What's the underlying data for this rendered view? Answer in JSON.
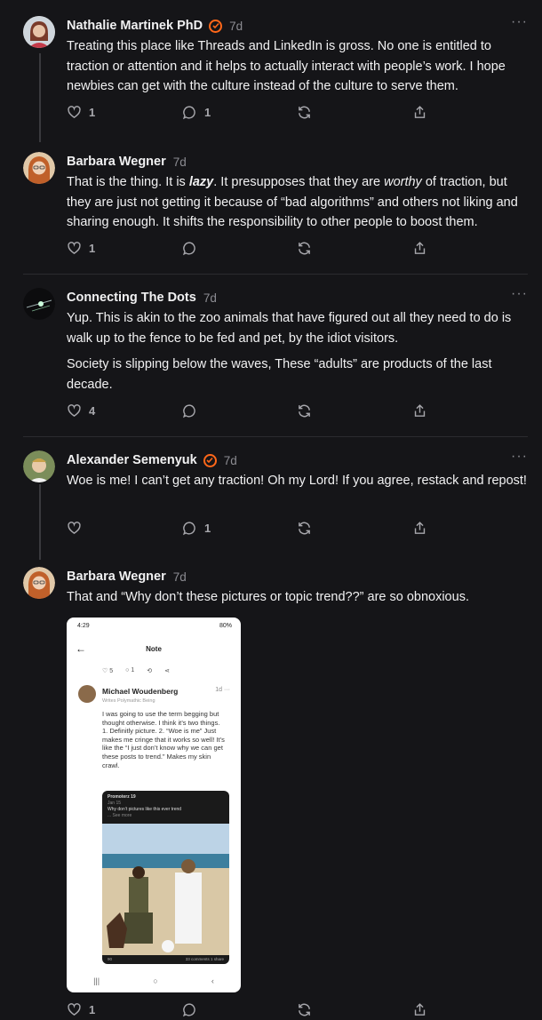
{
  "posts": [
    {
      "author": "Nathalie Martinek PhD",
      "verified": true,
      "time": "7d",
      "paragraphs": [
        "Treating this place like Threads and LinkedIn is gross. No one is entitled to traction or attention and it helps to actually interact with people’s work. I hope newbies can get with the culture instead of the culture to serve them."
      ],
      "likes": "1",
      "comments": "1"
    },
    {
      "author": "Barbara Wegner",
      "verified": false,
      "time": "7d",
      "body_html": "That is the thing. It is <b><i>lazy</i></b>. It presupposes that they are <i>worthy</i> of traction, but they are just not getting it because of “bad algorithms” and others not liking and sharing enough. It shifts the responsibility to other people to boost them.",
      "likes": "1",
      "comments": ""
    },
    {
      "author": "Connecting The Dots",
      "verified": false,
      "time": "7d",
      "paragraphs": [
        "Yup. This is akin to the zoo animals that have figured out all they need to do is walk up to the fence to be fed and pet, by the idiot visitors.",
        "Society is slipping below the waves, These “adults” are products of the last decade."
      ],
      "likes": "4",
      "comments": ""
    },
    {
      "author": "Alexander Semenyuk",
      "verified": true,
      "time": "7d",
      "paragraphs": [
        "Woe is me! I can’t get any traction! Oh my Lord! If you agree, restack and repost!"
      ],
      "likes": "",
      "comments": "1"
    },
    {
      "author": "Barbara Wegner",
      "verified": false,
      "time": "7d",
      "paragraphs": [
        "That and “Why don’t these pictures or topic trend??” are so obnoxious."
      ],
      "likes": "1",
      "comments": ""
    }
  ],
  "screenshot": {
    "status_time": "4:29",
    "battery": "80%",
    "header": "Note",
    "likes": "5",
    "comments": "1",
    "author": "Michael Woudenberg",
    "subtitle": "Writes Polymathic Being",
    "time": "1d",
    "text": "I was going to use the term begging but thought otherwise. I think it’s two things. 1. Definitly picture. 2. “Woe is me” Just makes me cringe that it works so well! It’s like the “I just don’t know why we can get these posts to trend.” Makes my skin crawl.",
    "embed_author": "Promoterz 19",
    "embed_date": "Jan 15",
    "embed_text": "Why don’t pictures like this ever trend",
    "embed_more": "... See more",
    "embed_reactions": "90",
    "embed_stats": "33 comments  1 share"
  },
  "colors": {
    "accent": "#ff6719",
    "background": "#151518",
    "muted": "#8c8c92"
  },
  "icons": [
    "heart-icon",
    "comment-icon",
    "restack-icon",
    "share-icon",
    "more-icon",
    "verified-icon"
  ]
}
